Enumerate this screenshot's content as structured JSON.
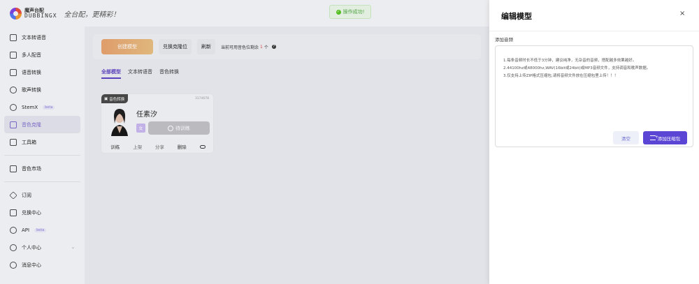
{
  "header": {
    "logo_cn": "魔声台配",
    "logo_en": "DUBBINGX",
    "slogan": "全台配，更精彩！"
  },
  "toast": {
    "text": "操作成功!",
    "icon": "check-circle-icon"
  },
  "sidebar": {
    "items": [
      {
        "label": "文本转语音",
        "icon": "doc-icon"
      },
      {
        "label": "多人配音",
        "icon": "doc-icon"
      },
      {
        "label": "语音转换",
        "icon": "convert-icon"
      },
      {
        "label": "歌声转换",
        "icon": "music-icon"
      },
      {
        "label": "StemX",
        "icon": "stem-icon",
        "badge": "beta"
      },
      {
        "label": "音色克隆",
        "icon": "clone-icon",
        "active": true
      },
      {
        "label": "工具箱",
        "icon": "toolbox-icon"
      },
      {
        "label": "音色市场",
        "icon": "store-icon"
      },
      {
        "label": "订阅",
        "icon": "diamond-icon"
      },
      {
        "label": "兑换中心",
        "icon": "gift-icon"
      },
      {
        "label": "API",
        "icon": "api-icon",
        "badge": "beta"
      },
      {
        "label": "个人中心",
        "icon": "user-icon"
      },
      {
        "label": "消息中心",
        "icon": "bell-icon"
      }
    ]
  },
  "main": {
    "create_button": "创建模型",
    "redeem_button": "兑换克隆位",
    "refresh_button": "刷新",
    "quota_text": "当前可用音色位剩余",
    "quota_count": "1",
    "quota_unit": "个",
    "tabs": [
      {
        "label": "全部模型",
        "active": true
      },
      {
        "label": "文本转语音"
      },
      {
        "label": "音色转换"
      }
    ],
    "card": {
      "badge": "音色转换",
      "id": "3174678",
      "name": "任素汐",
      "tag": "女",
      "status": "待训练",
      "actions": [
        "训练",
        "上架",
        "分享",
        "删除"
      ]
    }
  },
  "drawer": {
    "title": "编辑模型",
    "close": "×",
    "field_label": "添加音频",
    "notes": [
      "1.每条音频时长不低于3分钟，建议纯净，无杂音的音频，搭配越多效果越好。",
      "2.44100hz或48000hz,WAV(16bit或24bit)或MP3音频文件，支持调音和歌声数据。",
      "3.仅支持上传ZIP格式压缩包,请将音频文件放在压缩包里上传！！！"
    ],
    "clear_button": "清空",
    "add_button": "添加压缩包"
  }
}
